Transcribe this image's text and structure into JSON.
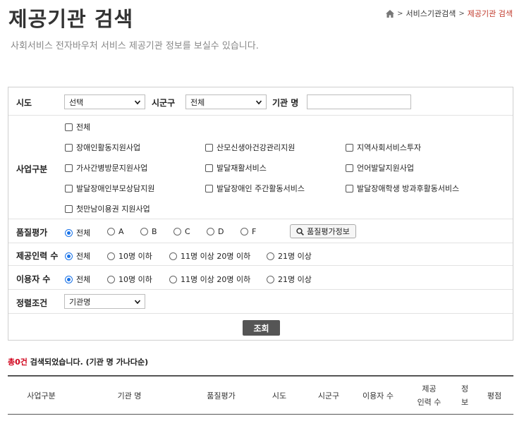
{
  "page": {
    "title": "제공기관 검색",
    "subtitle": "사회서비스 전자바우처 서비스 제공기관 정보를 보실수 있습니다."
  },
  "breadcrumb": {
    "home_icon": "home-icon",
    "items": [
      "서비스기관검색",
      "제공기관 검색"
    ],
    "sep": ">",
    "current_color": "#c0392b"
  },
  "filters": {
    "sido_label": "시도",
    "sido_value": "선택",
    "sigungu_label": "시군구",
    "sigungu_value": "전체",
    "agency_label": "기관 명",
    "agency_value": "",
    "business_label": "사업구분",
    "business_all": "전체",
    "business_items": [
      "장애인활동지원사업",
      "산모신생아건강관리지원",
      "지역사회서비스투자",
      "가사간병방문지원사업",
      "발달재활서비스",
      "언어발달지원사업",
      "발달장애인부모상담지원",
      "발달장애인 주간활동서비스",
      "발달장애학생 방과후활동서비스",
      "첫만남이용권 지원사업"
    ],
    "quality_label": "품질평가",
    "quality_options": [
      "전체",
      "A",
      "B",
      "C",
      "D",
      "F"
    ],
    "quality_selected": "전체",
    "quality_button": "품질평가정보",
    "staff_label": "제공인력 수",
    "staff_options": [
      "전체",
      "10명 이하",
      "11명 이상 20명 이하",
      "21명 이상"
    ],
    "users_label": "이용자 수",
    "users_options": [
      "전체",
      "10명 이하",
      "11명 이상 20명 이하",
      "21명 이상"
    ],
    "sort_label": "정렬조건",
    "sort_value": "기관명",
    "search_button": "조회",
    "accent_color": "#1a73e8"
  },
  "result": {
    "count_text": "총0건",
    "rest_text": " 검색되었습니다. (기관 명 가나다순)",
    "count_color": "#d0021b"
  },
  "table": {
    "headers": [
      "사업구분",
      "기관 명",
      "품질평가",
      "시도",
      "시군구",
      "이용자 수",
      "제공\n인력 수",
      "정\n보",
      "평점"
    ]
  }
}
